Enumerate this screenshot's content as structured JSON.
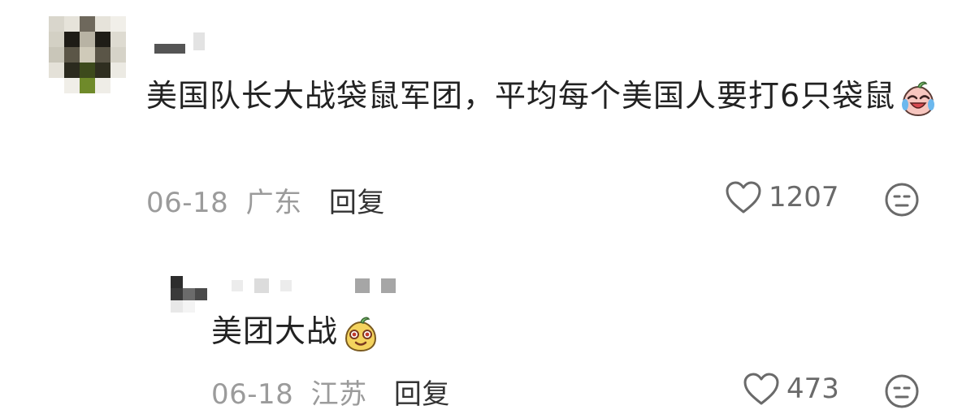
{
  "comments": [
    {
      "text": "美国队长大战袋鼠军团，平均每个美国人要打6只袋鼠",
      "emoji": "crying-laughing-peach-emoji",
      "date": "06-18",
      "location": "广东",
      "reply_label": "回复",
      "likes": "1207",
      "icons": [
        "heart-icon",
        "dislike-face-icon"
      ]
    },
    {
      "text": "美团大战",
      "emoji": "smirking-yellow-peach-emoji",
      "date": "06-18",
      "location": "江苏",
      "reply_label": "回复",
      "likes": "473",
      "icons": [
        "heart-icon",
        "dislike-face-icon"
      ]
    }
  ],
  "colors": {
    "text": "#222222",
    "meta": "#9b9b9b",
    "icon": "#666666",
    "background": "#ffffff"
  }
}
